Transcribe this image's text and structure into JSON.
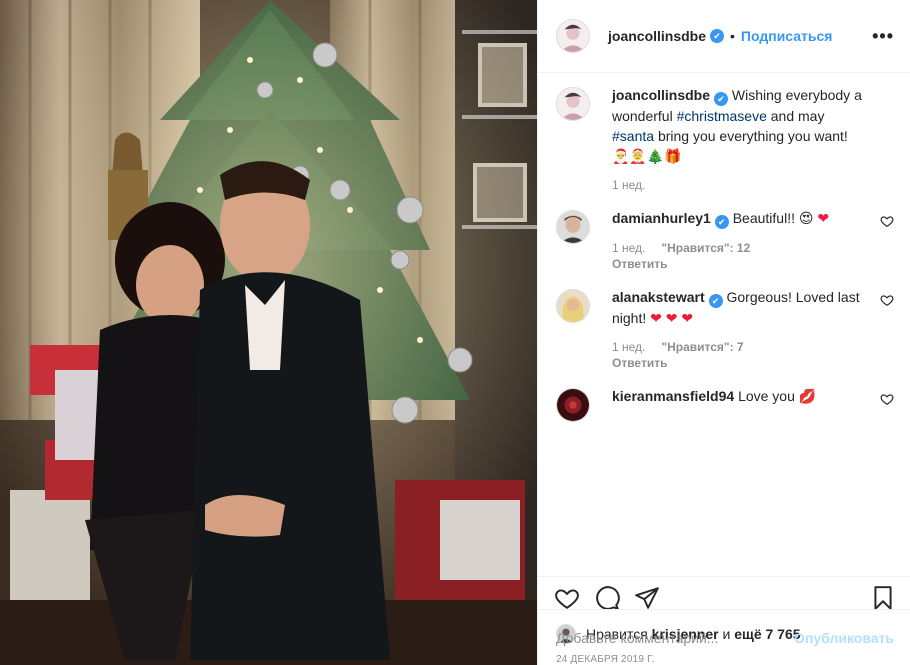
{
  "header": {
    "username": "joancollinsdbe",
    "verified_mark": "✔",
    "separator": "•",
    "follow_label": "Подписаться",
    "more_label": "•••"
  },
  "caption": {
    "username": "joancollinsdbe",
    "text_1": "Wishing everybody a wonderful",
    "hashtag_1": "#christmaseve",
    "text_2": "and may",
    "hashtag_2": "#santa",
    "text_3": "bring you everything you want!",
    "emojis": "🎅🤶🎄🎁",
    "time": "1 нед."
  },
  "comments": [
    {
      "username": "damianhurley1",
      "text": "Beautiful!!",
      "emoji": "😍",
      "emoji_2": "❤",
      "time": "1 нед.",
      "likes": "\"Нравится\": 12",
      "reply": "Ответить"
    },
    {
      "username": "alanakstewart",
      "text": "Gorgeous! Loved last night!",
      "emoji": "❤ ❤ ❤",
      "time": "1 нед.",
      "likes": "\"Нравится\": 7",
      "reply": "Ответить"
    },
    {
      "username": "kieranmansfield94",
      "text": "Love you",
      "emoji": "💋"
    }
  ],
  "likes_line": {
    "prefix": "Нравится",
    "user": "krisjenner",
    "middle": "и",
    "rest": "ещё 7 765"
  },
  "date": "24 ДЕКАБРЯ 2019 Г.",
  "add_comment": {
    "placeholder": "Добавьте комментарий...",
    "publish_label": "Опубликовать"
  },
  "icons": [
    "heart-icon",
    "comment-icon",
    "share-icon",
    "bookmark-icon",
    "more-icon",
    "verified-icon"
  ],
  "colors": {
    "accent": "#3897f0",
    "hashtag": "#003569",
    "muted": "#8e8e8e",
    "publish_disabled": "#b2dffc"
  }
}
